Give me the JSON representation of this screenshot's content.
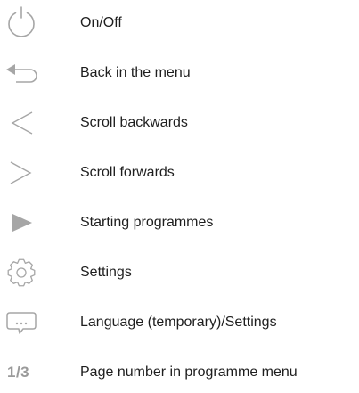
{
  "colors": {
    "icon_gray": "#a6a6a6",
    "text": "#1e1e1e"
  },
  "items": [
    {
      "icon": "power-icon",
      "label": "On/Off"
    },
    {
      "icon": "back-arrow-icon",
      "label": "Back in the menu"
    },
    {
      "icon": "chevron-left-icon",
      "label": "Scroll backwards"
    },
    {
      "icon": "chevron-right-icon",
      "label": "Scroll forwards"
    },
    {
      "icon": "play-icon",
      "label": "Starting programmes"
    },
    {
      "icon": "gear-icon",
      "label": "Settings"
    },
    {
      "icon": "speech-bubble-icon",
      "label": "Language (temporary)/Settings"
    },
    {
      "icon": "page-number-icon",
      "icon_text": "1/3",
      "label": "Page number in programme menu"
    }
  ]
}
